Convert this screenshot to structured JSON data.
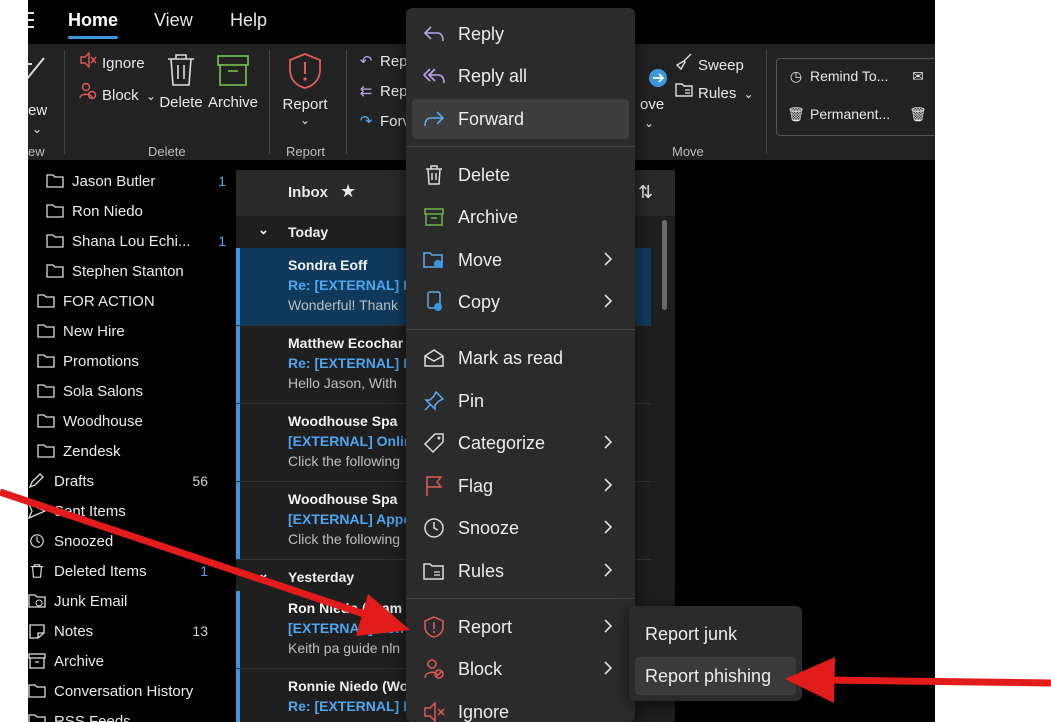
{
  "tabs": [
    {
      "label": "Home"
    },
    {
      "label": "View"
    },
    {
      "label": "Help"
    }
  ],
  "ribbon": {
    "new_partial": "ew",
    "view_partial": "ew",
    "ignore": "Ignore",
    "block": "Block",
    "delete": "Delete",
    "archive": "Archive",
    "delete_group": "Delete",
    "report": "Report",
    "report_group": "Report",
    "reply_partial": "Repl",
    "reply_all_partial": "Repl",
    "forward_partial": "Forv",
    "move_partial": "ove",
    "sweep": "Sweep",
    "rules": "Rules",
    "move_group": "Move",
    "remind": "Remind To...",
    "permanent": "Permanent..."
  },
  "folders": [
    {
      "label": "Jason Butler",
      "count": "1",
      "count_style": "blue"
    },
    {
      "label": "Ron Niedo",
      "count": ""
    },
    {
      "label": "Shana Lou Echi...",
      "count": "1",
      "count_style": "blue"
    },
    {
      "label": "Stephen Stanton",
      "count": ""
    },
    {
      "label": "FOR ACTION",
      "count": ""
    },
    {
      "label": "New Hire",
      "count": ""
    },
    {
      "label": "Promotions",
      "count": ""
    },
    {
      "label": "Sola Salons",
      "count": ""
    },
    {
      "label": "Woodhouse",
      "count": ""
    },
    {
      "label": "Zendesk",
      "count": ""
    },
    {
      "label": "Drafts",
      "count": "56",
      "count_style": "gray"
    },
    {
      "label": "Sent Items",
      "count": ""
    },
    {
      "label": "Snoozed",
      "count": ""
    },
    {
      "label": "Deleted Items",
      "count": "1",
      "count_style": "blue"
    },
    {
      "label": "Junk Email",
      "count": ""
    },
    {
      "label": "Notes",
      "count": "13",
      "count_style": "gray"
    },
    {
      "label": "Archive",
      "count": ""
    },
    {
      "label": "Conversation History",
      "count": ""
    },
    {
      "label": "RSS Feeds",
      "count": ""
    }
  ],
  "message_list": {
    "title": "Inbox",
    "today_label": "Today",
    "yesterday_label": "Yesterday",
    "messages": [
      {
        "from": "Sondra Eoff",
        "subject": "Re: [EXTERNAL] R",
        "preview": "Wonderful! Thank"
      },
      {
        "from": "Matthew Ecochar",
        "subject": "Re: [EXTERNAL] R",
        "preview": "Hello Jason, With"
      },
      {
        "from": "Woodhouse Spa",
        "subject": "[EXTERNAL] Onlin",
        "preview": "Click the following"
      },
      {
        "from": "Woodhouse Spa",
        "subject": "[EXTERNAL] Appo",
        "preview": "Click the following"
      },
      {
        "from": "Ron Niedo (Team",
        "subject": "[EXTERNAL] Ron",
        "preview": "Keith pa guide nln"
      },
      {
        "from": "Ronnie Niedo (Wo",
        "subject": "Re: [EXTERNAL] F",
        "preview": ""
      }
    ]
  },
  "context_menu": {
    "items": [
      {
        "label": "Reply"
      },
      {
        "label": "Reply all"
      },
      {
        "label": "Forward"
      },
      {
        "label": "Delete"
      },
      {
        "label": "Archive"
      },
      {
        "label": "Move"
      },
      {
        "label": "Copy"
      },
      {
        "label": "Mark as read"
      },
      {
        "label": "Pin"
      },
      {
        "label": "Categorize"
      },
      {
        "label": "Flag"
      },
      {
        "label": "Snooze"
      },
      {
        "label": "Rules"
      },
      {
        "label": "Report"
      },
      {
        "label": "Block"
      },
      {
        "label": "Ignore"
      }
    ]
  },
  "report_submenu": {
    "items": [
      {
        "label": "Report junk"
      },
      {
        "label": "Report phishing"
      }
    ]
  },
  "colors": {
    "accent": "#3a96dd",
    "link": "#4ea6f0",
    "annotation_arrow": "#e21b1b",
    "report_icon": "#e05a5a",
    "archive_icon": "#6fb34a"
  }
}
